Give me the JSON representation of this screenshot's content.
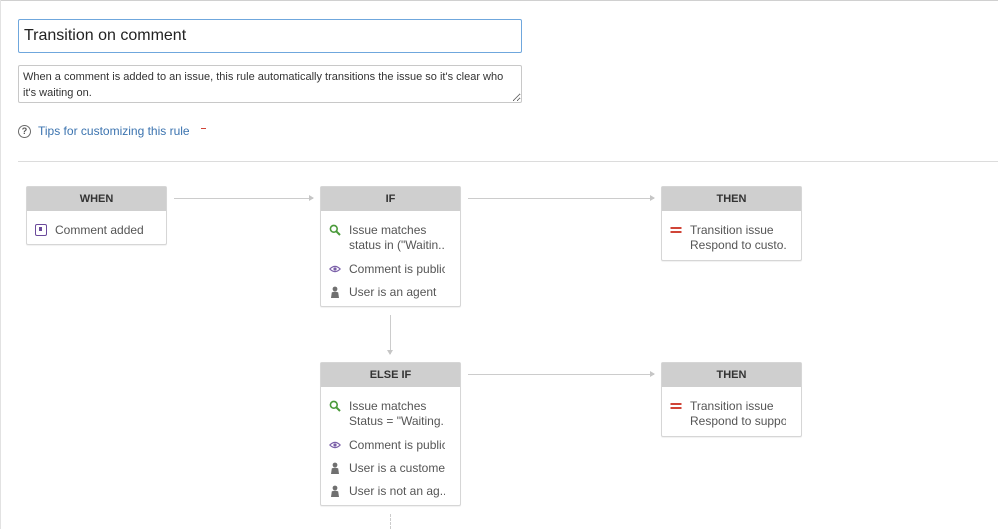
{
  "rule": {
    "name": "Transition on comment",
    "description": "When a comment is added to an issue, this rule automatically transitions the issue so it's clear who it's waiting on.",
    "tips_link": "Tips for customizing this rule",
    "help_glyph": "?"
  },
  "when_block": {
    "header": "WHEN",
    "items": [
      {
        "icon": "comment-trigger-icon",
        "text": "Comment added"
      }
    ]
  },
  "if_block": {
    "header": "IF",
    "items": [
      {
        "icon": "search-icon",
        "line1": "Issue matches",
        "line2": "status in (\"Waitin..."
      },
      {
        "icon": "eye-icon",
        "line1": "Comment is public"
      },
      {
        "icon": "user-icon",
        "line1": "User is an agent"
      }
    ]
  },
  "then_block_1": {
    "header": "THEN",
    "items": [
      {
        "icon": "transition-icon",
        "line1": "Transition issue",
        "line2": "Respond to custo..."
      }
    ]
  },
  "else_if_block": {
    "header": "ELSE IF",
    "items": [
      {
        "icon": "search-icon",
        "line1": "Issue matches",
        "line2": "Status = \"Waiting..."
      },
      {
        "icon": "eye-icon",
        "line1": "Comment is public"
      },
      {
        "icon": "user-icon",
        "line1": "User is a customer"
      },
      {
        "icon": "user-icon",
        "line1": "User is not an ag..."
      }
    ]
  },
  "then_block_2": {
    "header": "THEN",
    "items": [
      {
        "icon": "transition-icon",
        "line1": "Transition issue",
        "line2": "Respond to support"
      }
    ]
  },
  "colors": {
    "search_icon": "#4a9a3a",
    "eye_icon": "#7a5fa8",
    "user_icon": "#707070",
    "transition_icon": "#d04437",
    "trigger_icon": "#6b4a9b",
    "link": "#3b73af",
    "header_bg": "#cfcfcf"
  }
}
